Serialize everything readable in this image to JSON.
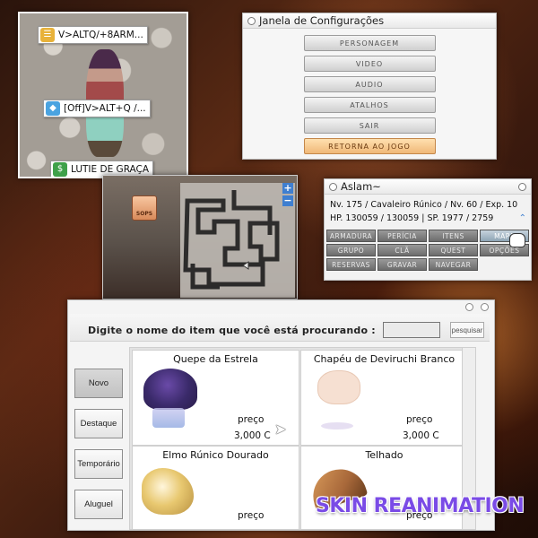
{
  "scene": {
    "labels": [
      {
        "text": "V>ALTQ/+8ARM...",
        "icon": "scroll-icon",
        "color": "#e8b23a"
      },
      {
        "text": "[Off]V>ALT+Q /...",
        "icon": "tag-icon",
        "color": "#4aa3e0"
      },
      {
        "text": "LUTIE DE GRAÇA",
        "icon": "money-bag-icon",
        "color": "#3fa14a"
      }
    ]
  },
  "config": {
    "title": "Janela de Configurações",
    "buttons": [
      "PERSONAGEM",
      "VIDEO",
      "AUDIO",
      "ATALHOS",
      "SAIR",
      "RETORNA AO JOGO"
    ]
  },
  "minimap": {
    "badge": "SOPS",
    "zoom_in": "+",
    "zoom_out": "−"
  },
  "status": {
    "name": "Aslam~",
    "line1": "Nv. 175 / Cavaleiro Rúnico / Nv. 60 / Exp. 10",
    "line2": "HP. 130059 / 130059 | SP. 1977 / 2759",
    "menu": [
      "ARMADURA",
      "PERÍCIA",
      "ITENS",
      "MAPA",
      "GRUPO",
      "CLÃ",
      "QUEST",
      "OPÇÕES",
      "RESERVAS",
      "GRAVAR",
      "NAVEGAR"
    ]
  },
  "shop": {
    "search_prompt": "Digite o nome do item que você está procurando :",
    "search_value": "",
    "search_button": "pesquisar",
    "categories": [
      "Novo",
      "Destaque",
      "Temporário",
      "Aluguel"
    ],
    "items": [
      {
        "name": "Quepe da Estrela",
        "price_label": "preço",
        "price": "3,000 C"
      },
      {
        "name": "Chapéu de Deviruchi Branco",
        "price_label": "preço",
        "price": "3,000 C"
      },
      {
        "name": "Elmo Rúnico Dourado",
        "price_label": "preço",
        "price": ""
      },
      {
        "name": "Telhado",
        "price_label": "preço",
        "price": ""
      }
    ]
  },
  "brand": "SKIN REANIMATION"
}
